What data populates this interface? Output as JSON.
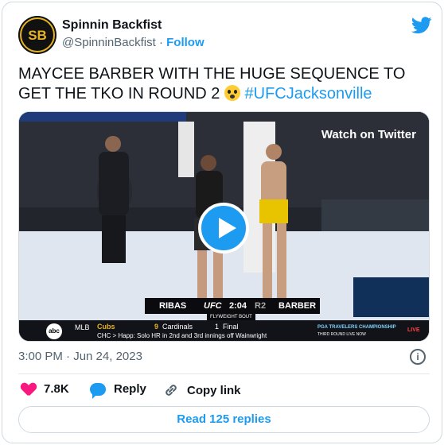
{
  "author": {
    "name": "Spinnin Backfist",
    "handle": "@SpinninBackfist",
    "separator": "·",
    "follow_label": "Follow",
    "avatar_text": "SB"
  },
  "tweet": {
    "text": "MAYCEE BARBER WITH THE HUGE SEQUENCE TO GET THE TKO IN ROUND 2 ",
    "hashtag": "#UFCJacksonville",
    "emoji": "flushed-face"
  },
  "media": {
    "watch_label": "Watch on Twitter",
    "score": {
      "fighter_left": "RIBAS",
      "brand": "UFC",
      "clock": "2:04",
      "round": "R2",
      "fighter_right": "BARBER",
      "division": "FLYWEIGHT BOUT"
    },
    "ticker": {
      "network": "abc",
      "league": "MLB",
      "team1": "Cubs",
      "score1": "9",
      "team2": "Cardinals",
      "score2": "1",
      "status": "Final",
      "note": "CHC > Happ: Solo HR in 2nd and 3rd innings off Wainwright",
      "right_text": "PGA TRAVELERS CHAMPIONSHIP",
      "right_sub": "THIRD ROUND LIVE NOW",
      "live": "LIVE"
    }
  },
  "timestamp": "3:00 PM · Jun 24, 2023",
  "actions": {
    "likes": "7.8K",
    "reply_label": "Reply",
    "copy_label": "Copy link"
  },
  "read_replies_label": "Read 125 replies",
  "colors": {
    "accent": "#1d9bf0",
    "like": "#f91880",
    "text": "#0f1419",
    "muted": "#536471"
  }
}
